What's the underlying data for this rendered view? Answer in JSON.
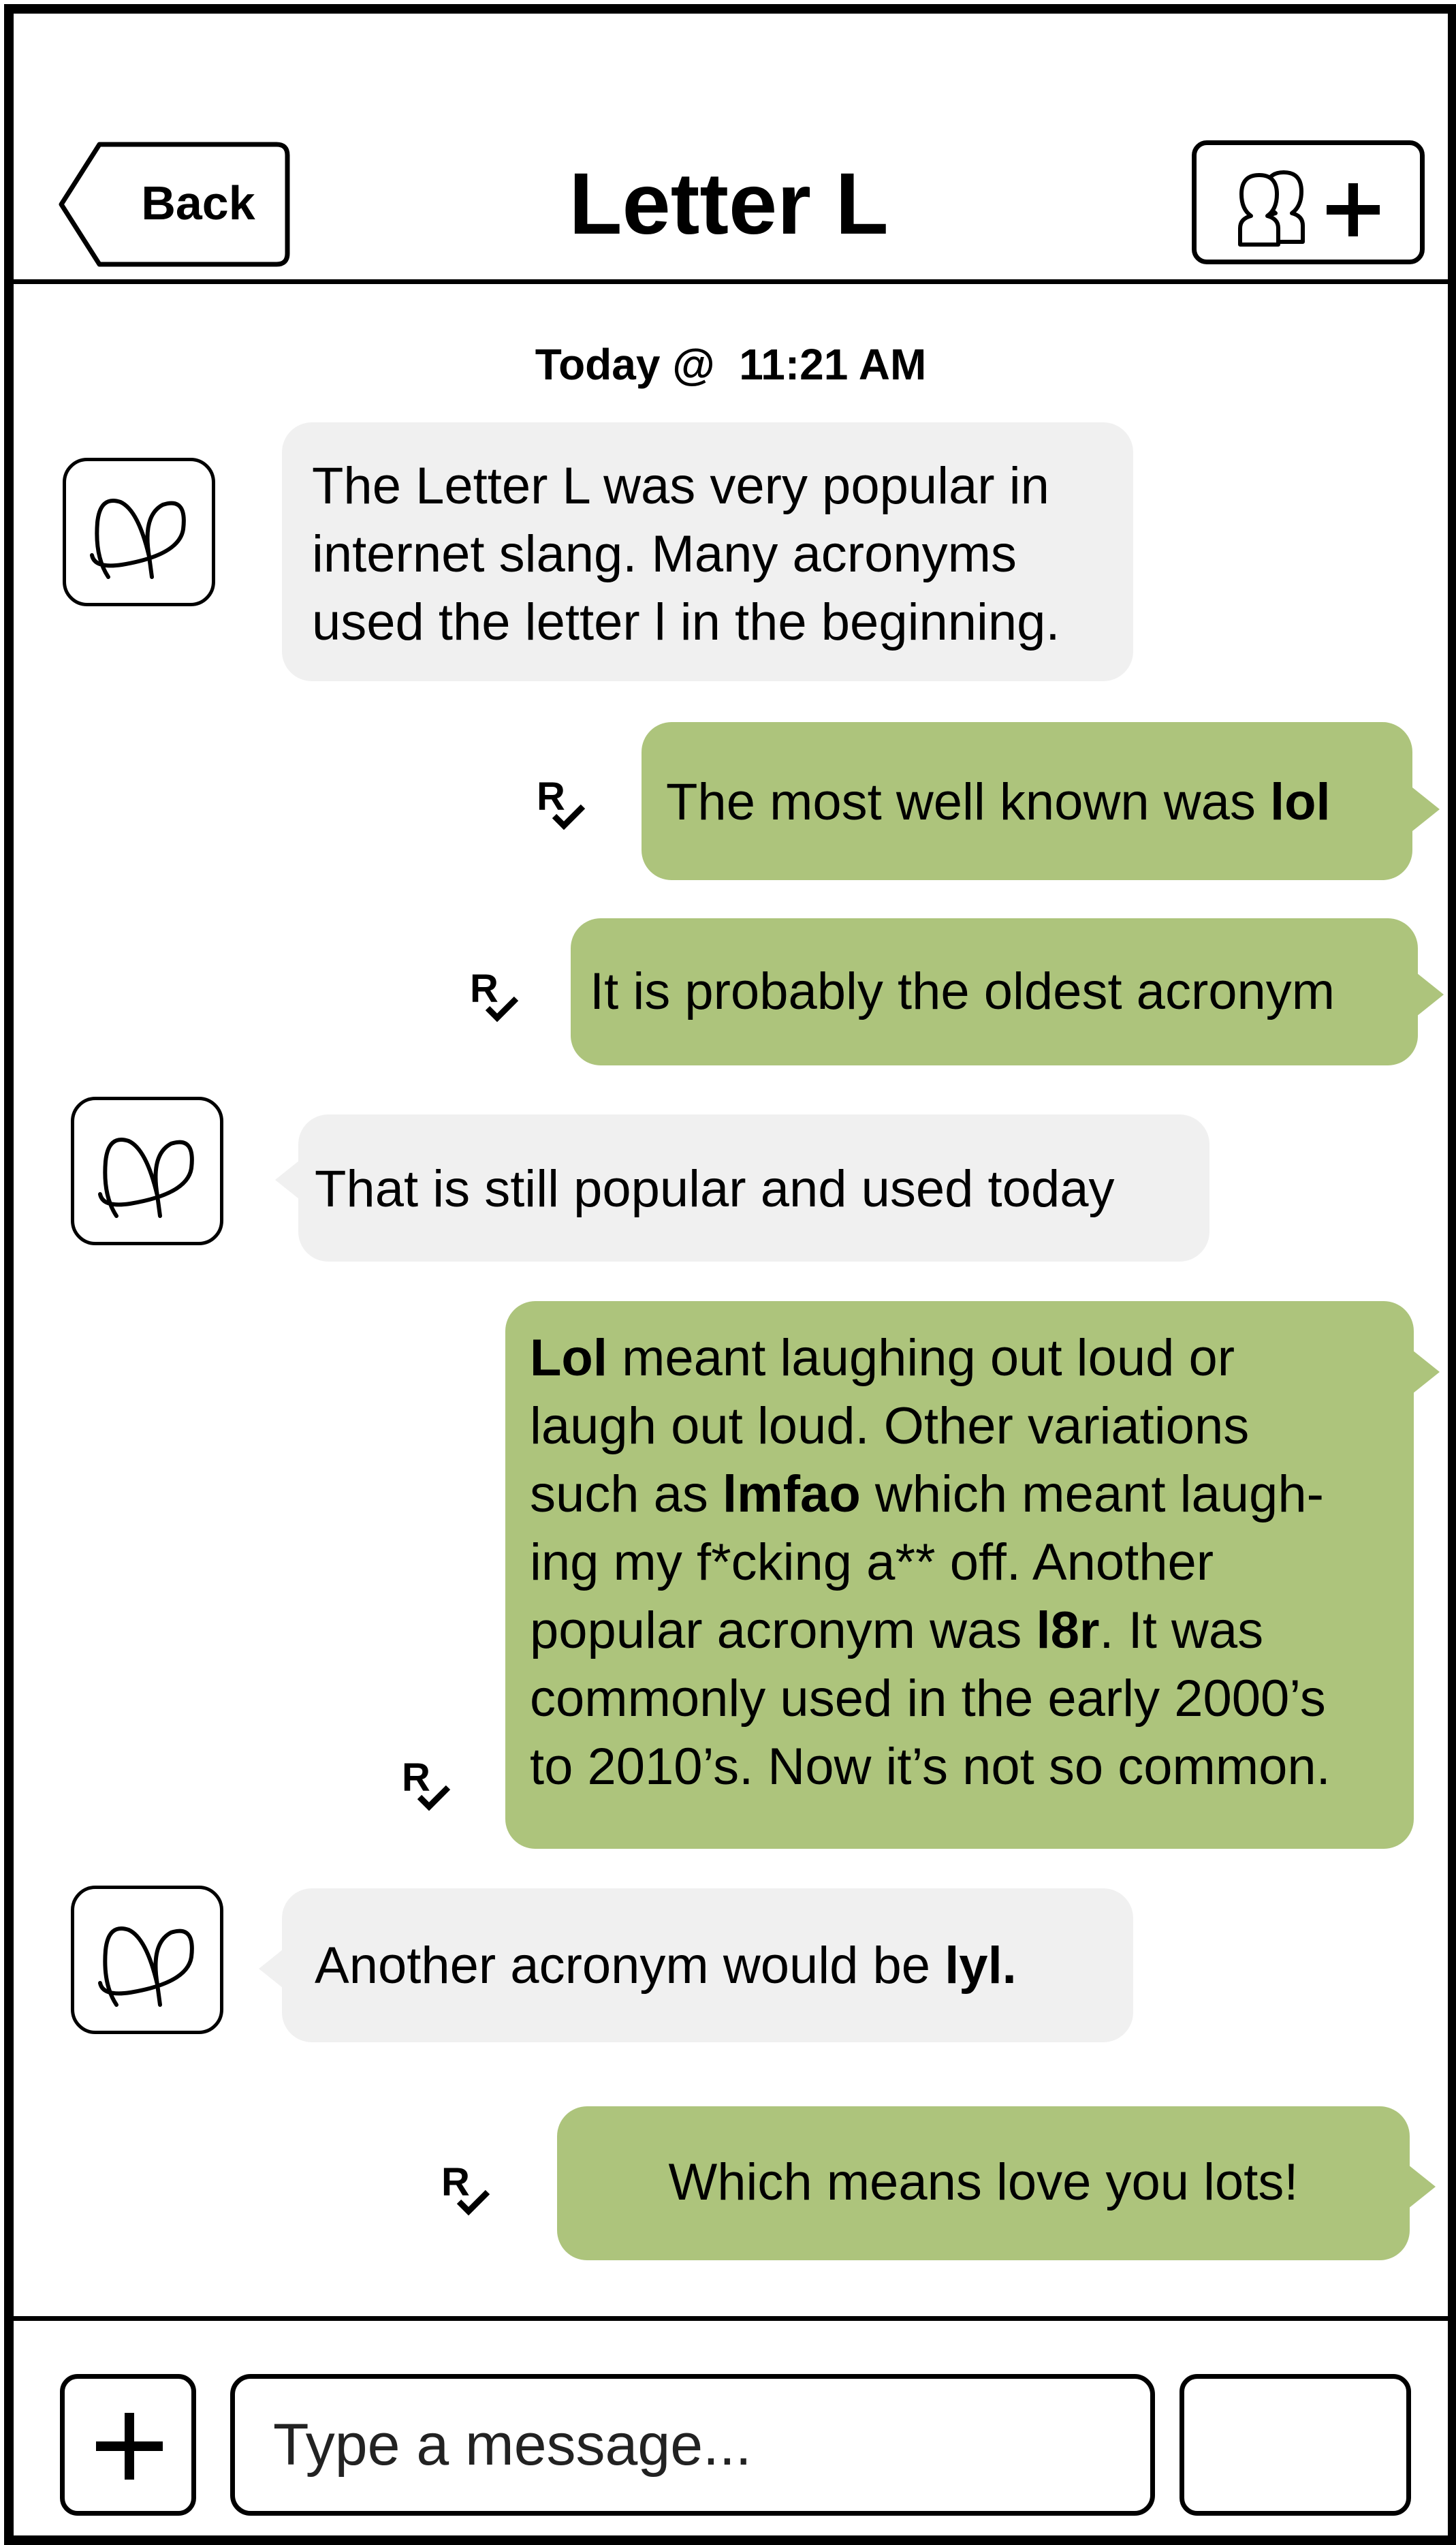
{
  "header": {
    "back_label": "Back",
    "title": "Letter L",
    "add_contact_icon": "add-contact-icon"
  },
  "conversation": {
    "timestamp": "Today @  11:21 AM",
    "read_receipt_letter": "R",
    "messages": [
      {
        "direction": "incoming",
        "lines": [
          "The Letter L was very popular in",
          "internet slang. Many acronyms",
          "used the letter l in the beginning."
        ]
      },
      {
        "direction": "outgoing",
        "text_before": "The most well known was ",
        "bold": "lol"
      },
      {
        "direction": "outgoing",
        "text": "It is probably the oldest acronym"
      },
      {
        "direction": "incoming",
        "text": "That is still popular and used today"
      },
      {
        "direction": "outgoing",
        "line1_bold": "Lol",
        "line1_rest": " meant laughing out loud or",
        "line2": "laugh out loud. Other variations",
        "line3_before": "such as ",
        "line3_bold": "lmfao",
        "line3_after": " which meant laugh-",
        "line4": "ing my f*cking a** off. Another",
        "line5_before": "popular acronym was ",
        "line5_bold": "l8r",
        "line5_after": ". It was",
        "line6": "commonly used in the early 2000’s",
        "line7": "to 2010’s. Now it’s not so common."
      },
      {
        "direction": "incoming",
        "text_before": "Another acronym would be ",
        "bold": "lyl."
      },
      {
        "direction": "outgoing",
        "text": "Which means love you lots!"
      }
    ]
  },
  "composer": {
    "placeholder": "Type a message...",
    "add_icon": "plus-icon"
  },
  "colors": {
    "outgoing_bubble": "#adc47c",
    "incoming_bubble": "#f0f0f0",
    "border": "#000000"
  }
}
